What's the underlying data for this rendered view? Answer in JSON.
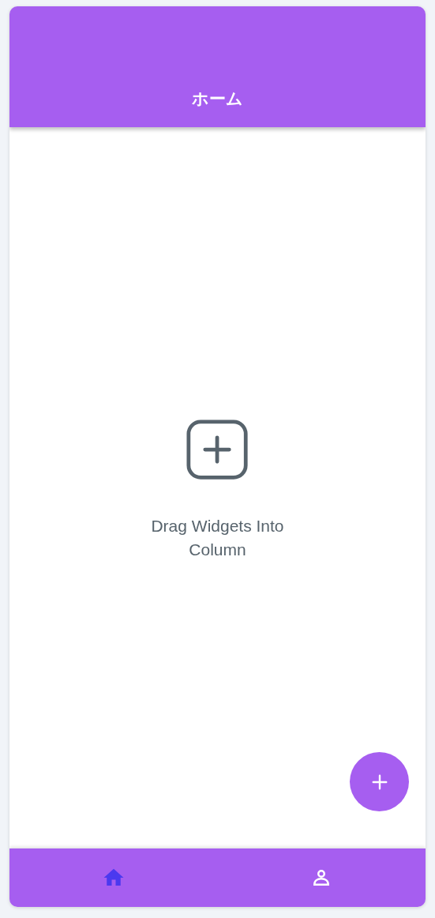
{
  "app_bar": {
    "title": "ホーム"
  },
  "empty_state": {
    "message": "Drag Widgets Into Column"
  },
  "bottom_nav": {
    "items": [
      {
        "selected": true
      },
      {
        "selected": false
      }
    ]
  }
}
